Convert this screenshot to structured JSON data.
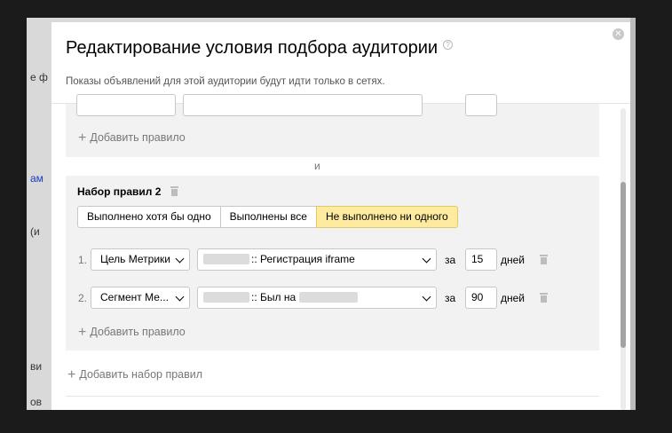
{
  "background": {
    "fragments": [
      "е ф",
      "ам",
      "(и",
      "ви",
      "ов"
    ]
  },
  "dialog": {
    "title": "Редактирование условия подбора аудитории",
    "help_icon": "question-circle-icon",
    "subtitle": "Показы объявлений для этой аудитории будут идти только в сетях.",
    "close_icon": "close-icon"
  },
  "set1": {
    "add_rule_label": "Добавить правило"
  },
  "and_label": "и",
  "set2": {
    "title": "Набор правил 2",
    "modes": [
      "Выполнено хотя бы одно",
      "Выполнены все",
      "Не выполнено ни одного"
    ],
    "selected_mode": "Не выполнено ни одного",
    "rules": [
      {
        "num": "1.",
        "type": "Цель Метрики",
        "target": ":: Регистрация iframe",
        "za": "за",
        "days_value": "15",
        "days_label": "дней"
      },
      {
        "num": "2.",
        "type": "Сегмент Ме...",
        "target": ":: Был на",
        "za": "за",
        "days_value": "90",
        "days_label": "дней"
      }
    ],
    "add_rule_label": "Добавить правило"
  },
  "add_set_label": "Добавить набор правил",
  "colors": {
    "active_mode_bg": "#ffeba0",
    "block_bg": "#f2f2f2"
  }
}
